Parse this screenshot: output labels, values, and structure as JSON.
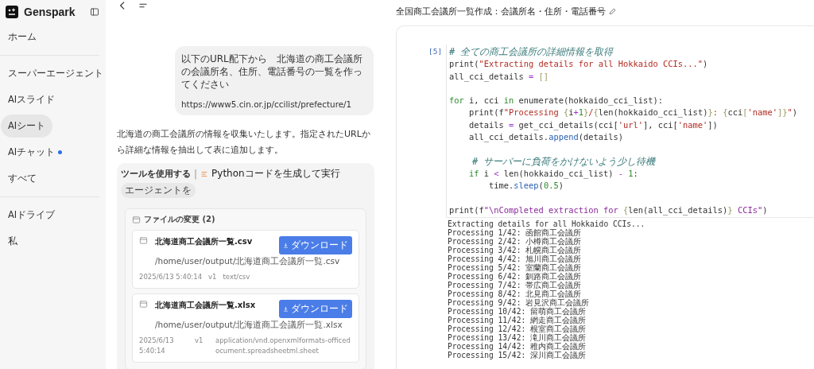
{
  "sidebar": {
    "brand": "Genspark",
    "groups": [
      [
        {
          "label": "ホーム",
          "selected": false,
          "dot": false
        }
      ],
      [
        {
          "label": "スーパーエージェント",
          "selected": false,
          "dot": false
        },
        {
          "label": "AIスライド",
          "selected": false,
          "dot": false
        },
        {
          "label": "AIシート",
          "selected": true,
          "dot": false
        },
        {
          "label": "AIチャット",
          "selected": false,
          "dot": true
        },
        {
          "label": "すべて",
          "selected": false,
          "dot": false
        }
      ],
      [
        {
          "label": "AIドライブ",
          "selected": false,
          "dot": false
        },
        {
          "label": "私",
          "selected": false,
          "dot": false
        }
      ]
    ]
  },
  "chat": {
    "user_message": {
      "lines": [
        "以下のURL配下から　北海道の商工会議所の会議所名、住所、電話番号の一覧を作ってください"
      ],
      "url": "https://www5.cin.or.jp/ccilist/prefecture/1"
    },
    "reply": "北海道の商工会議所の情報を収集いたします。指定されたURLから詳細な情報を抽出して表に追加します。",
    "tool": {
      "label": "ツールを使用する",
      "separator": "|",
      "action": "Pythonコードを生成して実行",
      "chip": "エージェントを",
      "changes_title": "ファイルの変更 (2)",
      "files": [
        {
          "name": "北海道商工会議所一覧.csv",
          "path": "/home/user/output/北海道商工会議所一覧.csv",
          "date": "2025/6/13 5:40:14",
          "version": "v1",
          "mime": "text/csv",
          "button": "ダウンロード"
        },
        {
          "name": "北海道商工会議所一覧.xlsx",
          "path": "/home/user/output/北海道商工会議所一覧.xlsx",
          "date": "2025/6/13 5:40:14",
          "version": "v1",
          "mime": "application/vnd.openxmlformats-officedocument.spreadsheetml.sheet",
          "button": "ダウンロード"
        }
      ]
    }
  },
  "notebook": {
    "title": "全国商工会議所一覧作成：会議所名・住所・電話番号",
    "cell_number": "[5]",
    "code": [
      {
        "kind": "code",
        "tokens": [
          {
            "t": "# 全ての商工会議所の詳細情報を取得",
            "kind": "comment"
          }
        ]
      },
      {
        "kind": "code",
        "tokens": [
          {
            "t": "print(",
            "kind": "plain"
          },
          {
            "t": "\"Extracting details for all Hokkaido CCIs...\"",
            "kind": "string"
          },
          {
            "t": ")",
            "kind": "plain"
          }
        ]
      },
      {
        "kind": "code",
        "tokens": [
          {
            "t": "all_cci_details ",
            "kind": "plain"
          },
          {
            "t": "=",
            "kind": "op"
          },
          {
            "t": " []",
            "kind": "brace"
          }
        ]
      },
      {
        "kind": "blank"
      },
      {
        "kind": "code",
        "tokens": [
          {
            "t": "for",
            "kind": "keyword"
          },
          {
            "t": " i, cci ",
            "kind": "plain"
          },
          {
            "t": "in",
            "kind": "keyword"
          },
          {
            "t": " enumerate(hokkaido_cci_list):",
            "kind": "plain"
          }
        ]
      },
      {
        "kind": "code",
        "tokens": [
          {
            "t": "    print(f",
            "kind": "plain"
          },
          {
            "t": "\"Processing ",
            "kind": "string"
          },
          {
            "t": "{",
            "kind": "brace"
          },
          {
            "t": "i",
            "kind": "plain"
          },
          {
            "t": "+",
            "kind": "op"
          },
          {
            "t": "1",
            "kind": "number"
          },
          {
            "t": "}",
            "kind": "brace"
          },
          {
            "t": "/",
            "kind": "string"
          },
          {
            "t": "{",
            "kind": "brace"
          },
          {
            "t": "len(hokkaido_cci_list)",
            "kind": "plain"
          },
          {
            "t": "}",
            "kind": "brace"
          },
          {
            "t": ": ",
            "kind": "string"
          },
          {
            "t": "{",
            "kind": "brace"
          },
          {
            "t": "cci",
            "kind": "plain"
          },
          {
            "t": "[",
            "kind": "brace"
          },
          {
            "t": "'name'",
            "kind": "string"
          },
          {
            "t": "]}",
            "kind": "brace"
          },
          {
            "t": "\"",
            "kind": "string"
          },
          {
            "t": ")",
            "kind": "plain"
          }
        ]
      },
      {
        "kind": "code",
        "tokens": [
          {
            "t": "    details ",
            "kind": "plain"
          },
          {
            "t": "=",
            "kind": "op"
          },
          {
            "t": " get_cci_details(cci[",
            "kind": "plain"
          },
          {
            "t": "'url'",
            "kind": "string"
          },
          {
            "t": "], cci[",
            "kind": "plain"
          },
          {
            "t": "'name'",
            "kind": "string"
          },
          {
            "t": "])",
            "kind": "plain"
          }
        ]
      },
      {
        "kind": "code",
        "tokens": [
          {
            "t": "    all_cci_details.",
            "kind": "plain"
          },
          {
            "t": "append",
            "kind": "method"
          },
          {
            "t": "(details)",
            "kind": "plain"
          }
        ]
      },
      {
        "kind": "blank"
      },
      {
        "kind": "code",
        "tokens": [
          {
            "t": "    # サーバーに負荷をかけないよう少し待機",
            "kind": "comment"
          }
        ]
      },
      {
        "kind": "code",
        "tokens": [
          {
            "t": "    if",
            "kind": "keyword"
          },
          {
            "t": " i ",
            "kind": "plain"
          },
          {
            "t": "<",
            "kind": "op"
          },
          {
            "t": " len(hokkaido_cci_list) ",
            "kind": "plain"
          },
          {
            "t": "- ",
            "kind": "op"
          },
          {
            "t": "1",
            "kind": "number"
          },
          {
            "t": ":",
            "kind": "plain"
          }
        ]
      },
      {
        "kind": "code",
        "tokens": [
          {
            "t": "        time.",
            "kind": "plain"
          },
          {
            "t": "sleep",
            "kind": "method"
          },
          {
            "t": "(",
            "kind": "plain"
          },
          {
            "t": "0.5",
            "kind": "number"
          },
          {
            "t": ")",
            "kind": "plain"
          }
        ]
      },
      {
        "kind": "blank"
      },
      {
        "kind": "code",
        "tokens": [
          {
            "t": "print(f",
            "kind": "plain"
          },
          {
            "t": "\"\\nCompleted extraction for ",
            "kind": "fstring"
          },
          {
            "t": "{",
            "kind": "brace"
          },
          {
            "t": "len(all_cci_details)",
            "kind": "plain"
          },
          {
            "t": "}",
            "kind": "brace"
          },
          {
            "t": " CCIs\"",
            "kind": "fstring"
          },
          {
            "t": ")",
            "kind": "plain"
          }
        ]
      }
    ],
    "output": [
      "Extracting details for all Hokkaido CCIs...",
      "Processing 1/42: 函館商工会議所",
      "Processing 2/42: 小樽商工会議所",
      "Processing 3/42: 札幌商工会議所",
      "Processing 4/42: 旭川商工会議所",
      "Processing 5/42: 室蘭商工会議所",
      "Processing 6/42: 釧路商工会議所",
      "Processing 7/42: 帯広商工会議所",
      "Processing 8/42: 北見商工会議所",
      "Processing 9/42: 岩見沢商工会議所",
      "Processing 10/42: 留萌商工会議所",
      "Processing 11/42: 網走商工会議所",
      "Processing 12/42: 根室商工会議所",
      "Processing 13/42: 滝川商工会議所",
      "Processing 14/42: 稚内商工会議所",
      "Processing 15/42: 深川商工会議所"
    ]
  }
}
